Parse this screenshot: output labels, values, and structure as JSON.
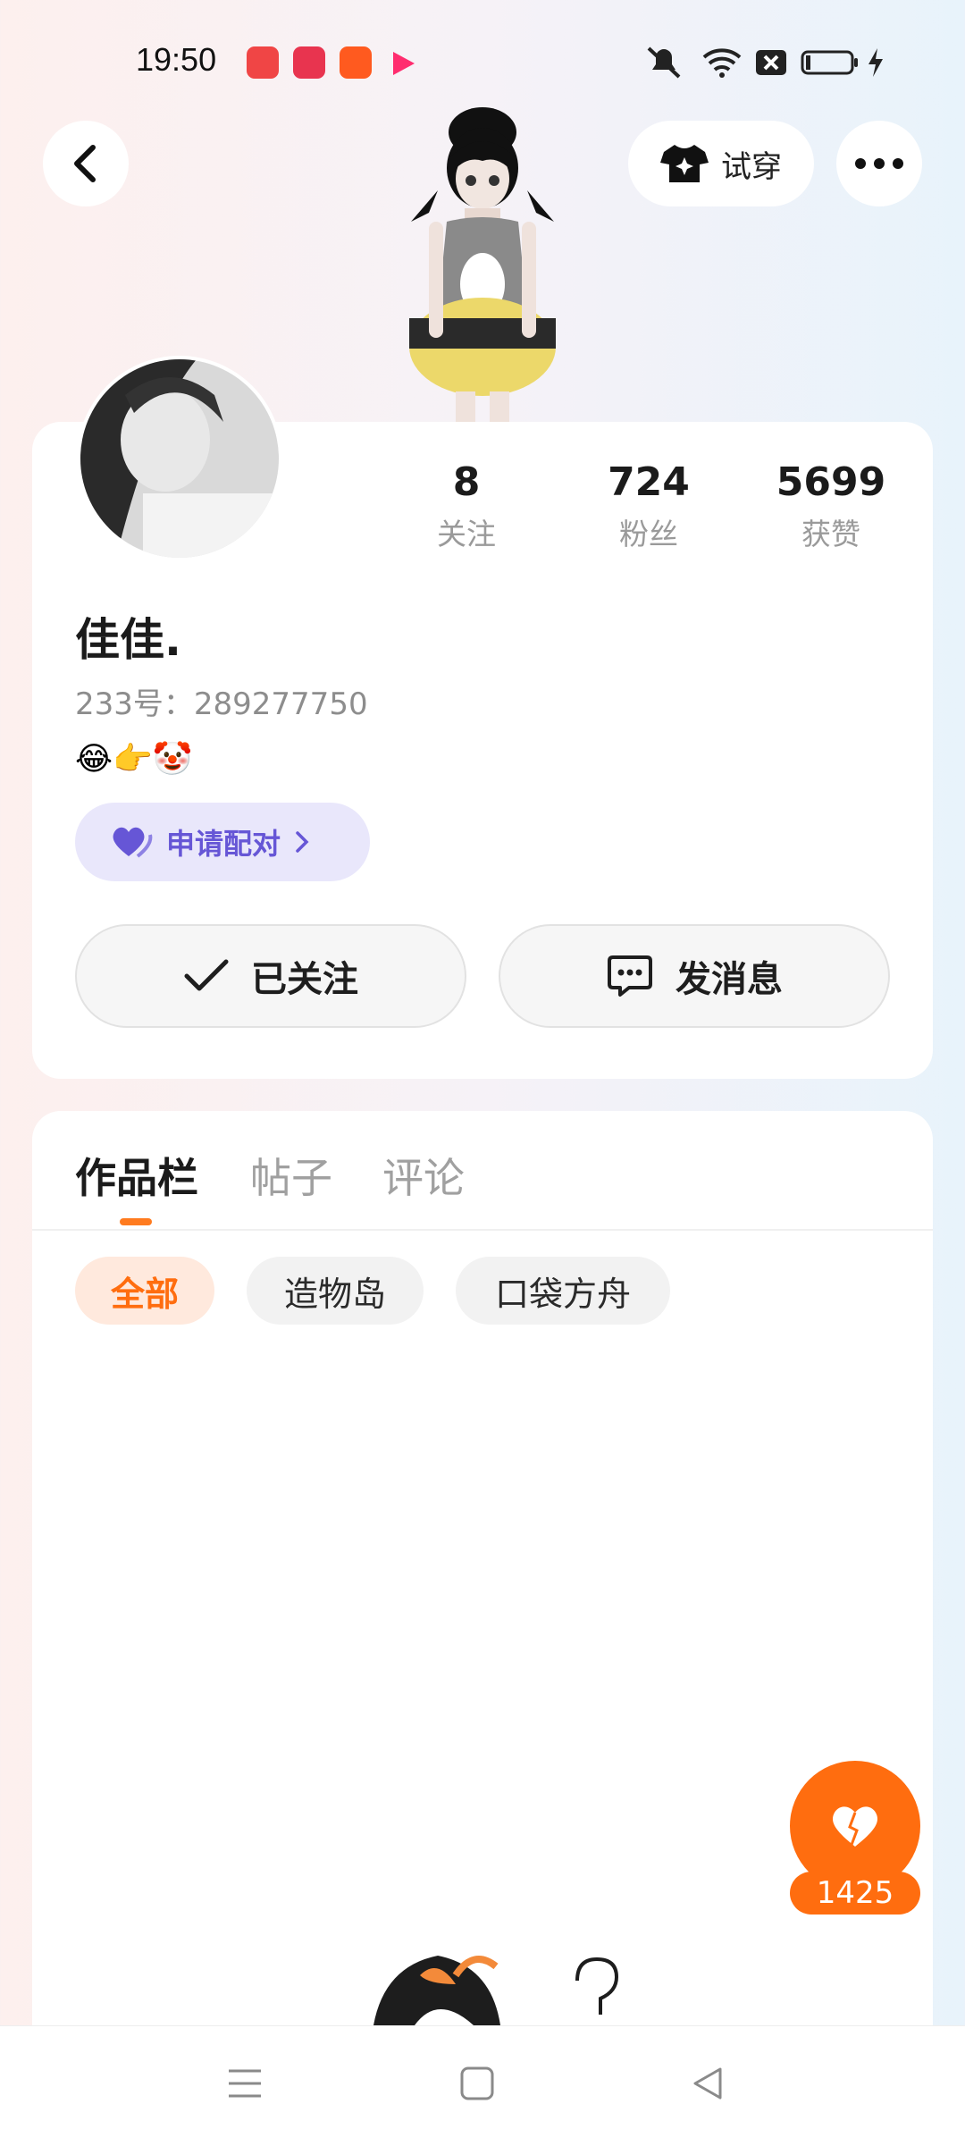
{
  "status_bar": {
    "time": "19:50",
    "app_icons": [
      {
        "name": "kuaishou-app-icon",
        "color": "#f04545"
      },
      {
        "name": "video-record-app-icon",
        "color": "#e8344f"
      },
      {
        "name": "kuaishou-lite-app-icon",
        "color": "#ff5a1f"
      },
      {
        "name": "play-app-icon",
        "color": "#ff2d6f"
      }
    ],
    "system_icons": [
      "mute-icon",
      "wifi-icon",
      "sim-off-icon",
      "battery-icon",
      "charging-icon"
    ]
  },
  "header": {
    "back_icon": "chevron-left-icon",
    "try_on_label": "试穿",
    "try_on_icon": "tshirt-icon",
    "more_icon": "more-dots-icon"
  },
  "profile": {
    "stats": [
      {
        "value": "8",
        "label": "关注"
      },
      {
        "value": "724",
        "label": "粉丝"
      },
      {
        "value": "5699",
        "label": "获赞"
      }
    ],
    "name": "佳佳.",
    "id_text": "233号：289277750",
    "bio_emoji": "😂👉🤡",
    "pair_label": "申请配对",
    "follow_button": "已关注",
    "message_button": "发消息"
  },
  "works": {
    "tabs": [
      "作品栏",
      "帖子",
      "评论"
    ],
    "active_tab": 0,
    "filters": [
      "全部",
      "造物岛",
      "口袋方舟"
    ],
    "active_filter": 0
  },
  "like_fab": {
    "count": "1425"
  },
  "colors": {
    "accent": "#ff6d0f",
    "pair_bg": "#e9e7fb",
    "pair_text": "#6656d6"
  },
  "nav_bar": [
    "menu-icon",
    "home-square-icon",
    "back-triangle-icon"
  ]
}
